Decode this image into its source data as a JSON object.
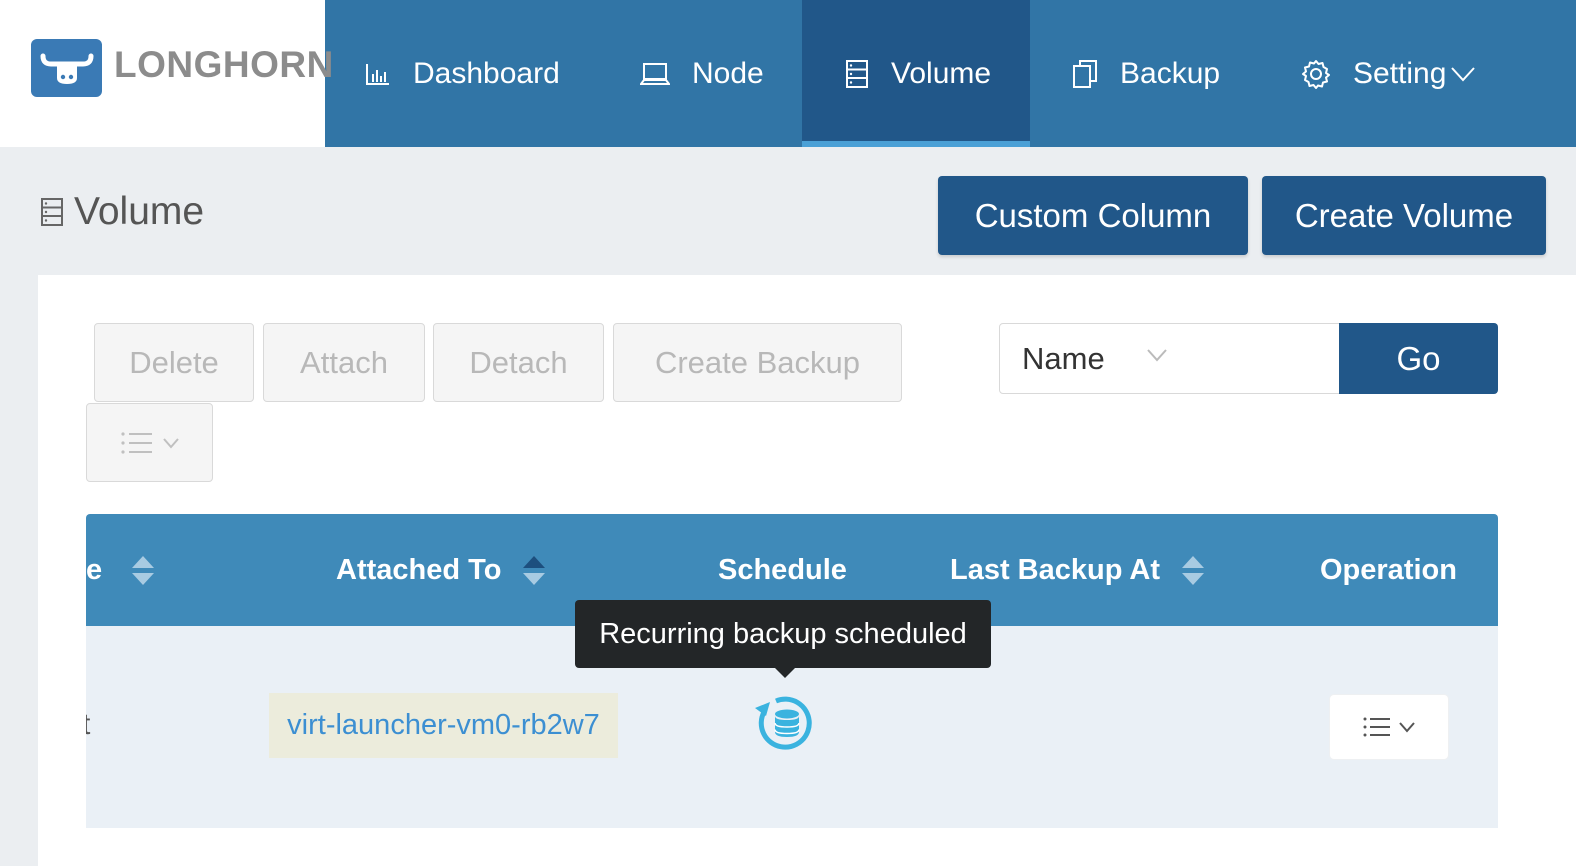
{
  "brand": {
    "name": "LONGHORN"
  },
  "nav": {
    "items": [
      {
        "label": "Dashboard",
        "icon": "bar-chart-icon"
      },
      {
        "label": "Node",
        "icon": "laptop-icon"
      },
      {
        "label": "Volume",
        "icon": "database-icon",
        "active": true
      },
      {
        "label": "Backup",
        "icon": "copy-icon"
      },
      {
        "label": "Setting",
        "icon": "gear-icon"
      }
    ]
  },
  "page": {
    "title": "Volume",
    "custom_column_label": "Custom Column",
    "create_volume_label": "Create Volume"
  },
  "toolbar": {
    "delete_label": "Delete",
    "attach_label": "Attach",
    "detach_label": "Detach",
    "create_backup_label": "Create Backup"
  },
  "search": {
    "field": "Name",
    "value": "",
    "go_label": "Go"
  },
  "table": {
    "headers": {
      "name_partial": "e",
      "attached_to": "Attached To",
      "schedule": "Schedule",
      "last_backup_at": "Last Backup At",
      "operation": "Operation"
    },
    "rows": [
      {
        "name_partial": "t",
        "attached_to": "virt-launcher-vm0-rb2w7",
        "schedule_icon": "recurring-backup-icon",
        "last_backup_at": ""
      }
    ]
  },
  "tooltip": {
    "text": "Recurring backup scheduled"
  },
  "colors": {
    "nav": "#3175a6",
    "nav_active": "#215789",
    "table_header": "#3f8ab9",
    "link": "#3c8fd2"
  }
}
